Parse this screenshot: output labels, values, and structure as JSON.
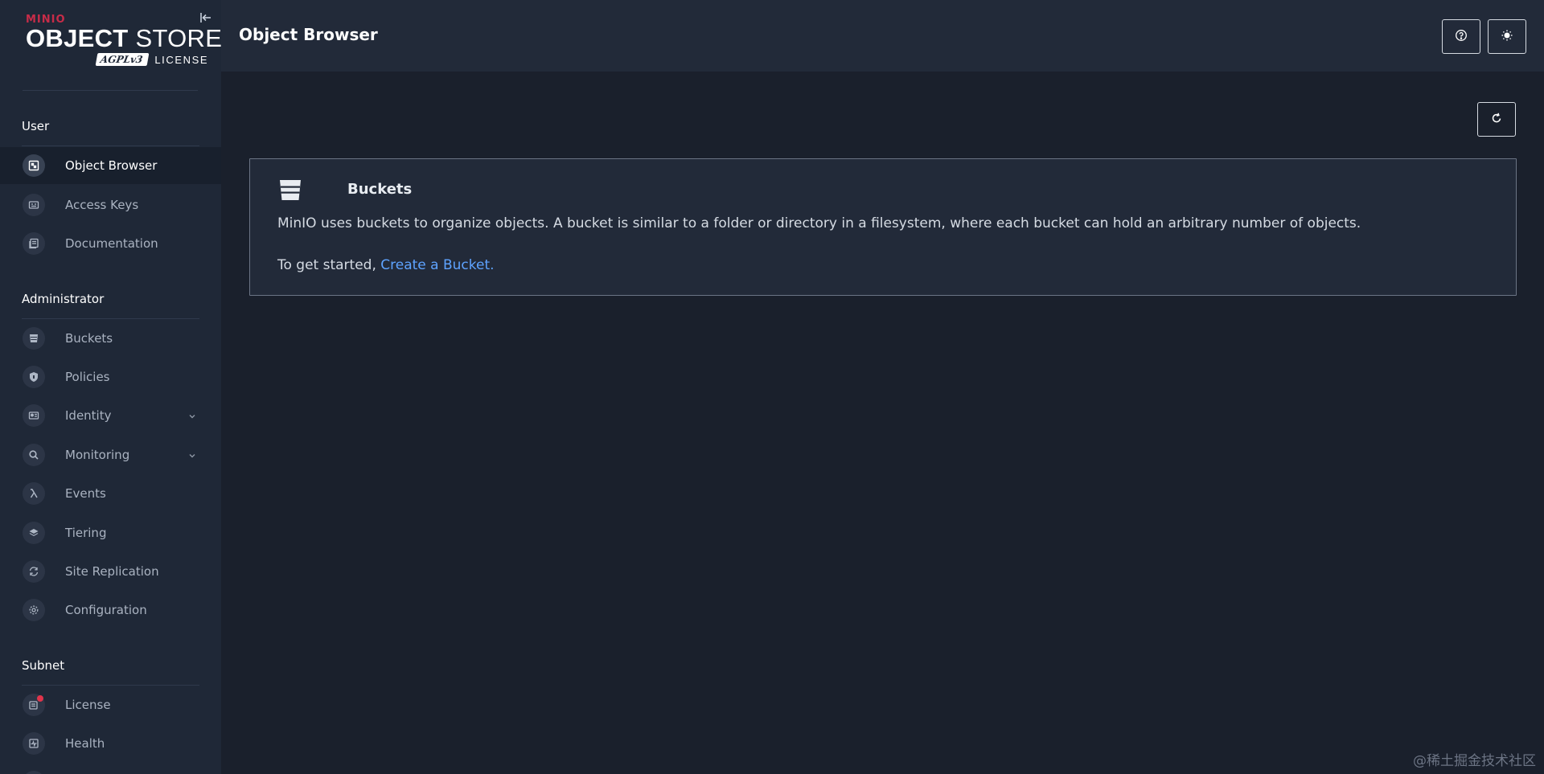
{
  "brand": {
    "minio": "MINIO",
    "product_bold": "OBJECT",
    "product_light": "STORE",
    "agpl": "AGPLv3",
    "license": "LICENSE"
  },
  "sidebar": {
    "sections": [
      {
        "label": "User"
      },
      {
        "label": "Administrator"
      },
      {
        "label": "Subnet"
      }
    ],
    "user_items": [
      {
        "label": "Object Browser",
        "icon": "object-browser-icon",
        "active": true
      },
      {
        "label": "Access Keys",
        "icon": "access-keys-icon"
      },
      {
        "label": "Documentation",
        "icon": "documentation-icon"
      }
    ],
    "admin_items": [
      {
        "label": "Buckets",
        "icon": "buckets-icon"
      },
      {
        "label": "Policies",
        "icon": "policies-icon"
      },
      {
        "label": "Identity",
        "icon": "identity-icon",
        "expandable": true
      },
      {
        "label": "Monitoring",
        "icon": "monitoring-icon",
        "expandable": true
      },
      {
        "label": "Events",
        "icon": "lambda-icon"
      },
      {
        "label": "Tiering",
        "icon": "tiering-icon"
      },
      {
        "label": "Site Replication",
        "icon": "site-replication-icon"
      },
      {
        "label": "Configuration",
        "icon": "gear-icon"
      }
    ],
    "subnet_items": [
      {
        "label": "License",
        "icon": "license-icon",
        "badge": true
      },
      {
        "label": "Health",
        "icon": "health-icon"
      }
    ]
  },
  "header": {
    "title": "Object Browser"
  },
  "main": {
    "box": {
      "title": "Buckets",
      "description": "MinIO uses buckets to organize objects. A bucket is similar to a folder or directory in a filesystem, where each bucket can hold an arbitrary number of objects.",
      "cta_prefix": "To get started, ",
      "cta_link": "Create a Bucket."
    }
  },
  "watermark": "@稀土掘金技术社区"
}
